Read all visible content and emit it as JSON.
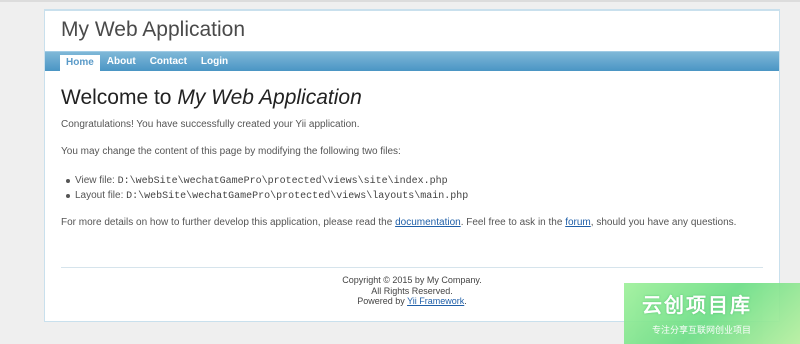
{
  "header": {
    "title": "My Web Application"
  },
  "menu": {
    "items": [
      {
        "label": "Home",
        "active": true
      },
      {
        "label": "About",
        "active": false
      },
      {
        "label": "Contact",
        "active": false
      },
      {
        "label": "Login",
        "active": false
      }
    ]
  },
  "content": {
    "heading_prefix": "Welcome to ",
    "heading_app": "My Web Application",
    "congrats": "Congratulations! You have successfully created your Yii application.",
    "intro": "You may change the content of this page by modifying the following two files:",
    "files": [
      {
        "label": "View file: ",
        "path": "D:\\webSite\\wechatGamePro\\protected\\views\\site\\index.php"
      },
      {
        "label": "Layout file: ",
        "path": "D:\\webSite\\wechatGamePro\\protected\\views\\layouts\\main.php"
      }
    ],
    "details_prefix": "For more details on how to further develop this application, please read the ",
    "documentation_link": "documentation",
    "details_middle": ". Feel free to ask in the ",
    "forum_link": "forum",
    "details_suffix": ", should you have any questions."
  },
  "footer": {
    "copyright": "Copyright © 2015 by My Company.",
    "rights": "All Rights Reserved.",
    "powered_prefix": "Powered by ",
    "powered_link": "Yii Framework",
    "powered_suffix": "."
  },
  "watermark": {
    "title": "云创项目库",
    "subtitle": "专注分享互联网创业项目"
  },
  "colors": {
    "menu_bar": "#4a95c4",
    "link": "#1f5fa8",
    "watermark": "#6cde86"
  }
}
